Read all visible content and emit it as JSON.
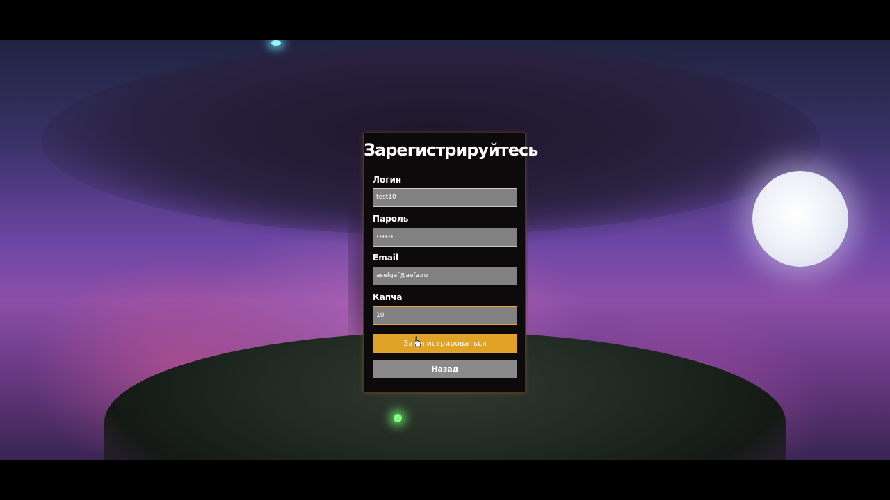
{
  "form": {
    "title": "Зарегистрируйтесь",
    "fields": [
      {
        "label": "Логин",
        "value": "test10"
      },
      {
        "label": "Пароль",
        "value": "••••••"
      },
      {
        "label": "Email",
        "value": "asefgef@aefa.ru"
      },
      {
        "label": "Капча",
        "value": "10"
      }
    ],
    "submit_label": "Зарегистрироваться",
    "back_label": "Назад"
  },
  "colors": {
    "accent": "#e0a227",
    "input_bg": "#818181",
    "panel_bg": "#0c0a0a",
    "focus_border": "#e8a33a"
  },
  "icons": {
    "cursor": "hand-pointer-icon"
  }
}
